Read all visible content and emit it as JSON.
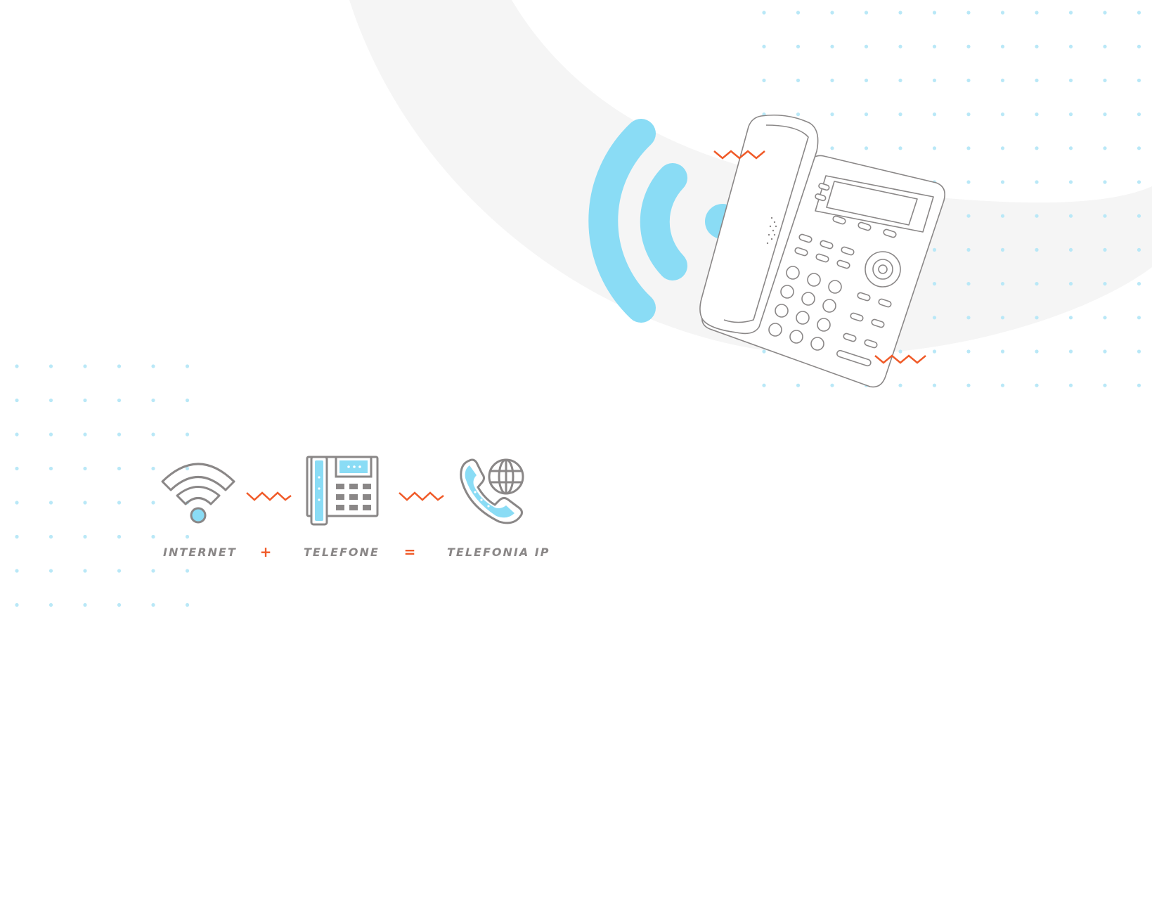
{
  "formula": {
    "term1": "INTERNET",
    "plus": "+",
    "term2": "TELEFONE",
    "equals": "=",
    "result": "TELEFONIA IP"
  },
  "colors": {
    "accent_blue": "#8adcf5",
    "accent_orange": "#f05a28",
    "outline_gray": "#8a8787",
    "arc_gray": "#f5f5f5",
    "dot_blue": "#b9e8f7"
  },
  "icons": {
    "wifi": "wifi-icon",
    "desk_phone": "desk-phone-icon",
    "voip": "voip-phone-globe-icon",
    "ip_phone": "ip-phone-illustration",
    "signal": "signal-waves-icon"
  }
}
